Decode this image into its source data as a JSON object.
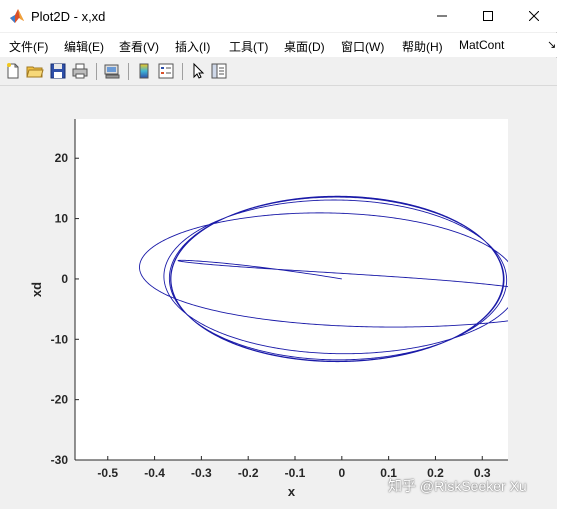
{
  "window": {
    "title": "Plot2D - x,xd",
    "controls": {
      "minimize": "minimize",
      "maximize": "maximize",
      "close": "close"
    }
  },
  "menu": {
    "items": [
      {
        "label": "文件(F)"
      },
      {
        "label": "编辑(E)"
      },
      {
        "label": "查看(V)"
      },
      {
        "label": "插入(I)"
      },
      {
        "label": "工具(T)"
      },
      {
        "label": "桌面(D)"
      },
      {
        "label": "窗口(W)"
      },
      {
        "label": "帮助(H)"
      },
      {
        "label": "MatCont"
      }
    ],
    "more": "↘"
  },
  "toolbar": {
    "tools": [
      "new-figure-icon",
      "open-folder-icon",
      "save-icon",
      "print-icon",
      "link-plot-icon",
      "colorbar-icon",
      "legend-icon",
      "pointer-icon",
      "property-editor-icon"
    ]
  },
  "chart_data": {
    "type": "line",
    "title": "",
    "xlabel": "x",
    "ylabel": "xd",
    "xlim": [
      -0.57,
      0.355
    ],
    "ylim": [
      -30,
      26.5
    ],
    "xticks": [
      -0.5,
      -0.4,
      -0.3,
      -0.2,
      -0.1,
      0,
      0.1,
      0.2,
      0.3
    ],
    "yticks": [
      -30,
      -20,
      -10,
      0,
      10,
      20
    ],
    "grid": false,
    "line_color": "#1a1aa8",
    "series": [
      {
        "description_only": true,
        "x_start": 0.0,
        "y_start": 0.0,
        "x_range": [
          -0.57,
          0.35
        ],
        "y_range": [
          -30.5,
          26.0
        ],
        "limit_cycle": {
          "x_center": -0.01,
          "x_amplitude": 0.355,
          "y_amplitude": 13.7
        }
      }
    ]
  },
  "watermark": "知乎 @RiskSeeker Xu"
}
